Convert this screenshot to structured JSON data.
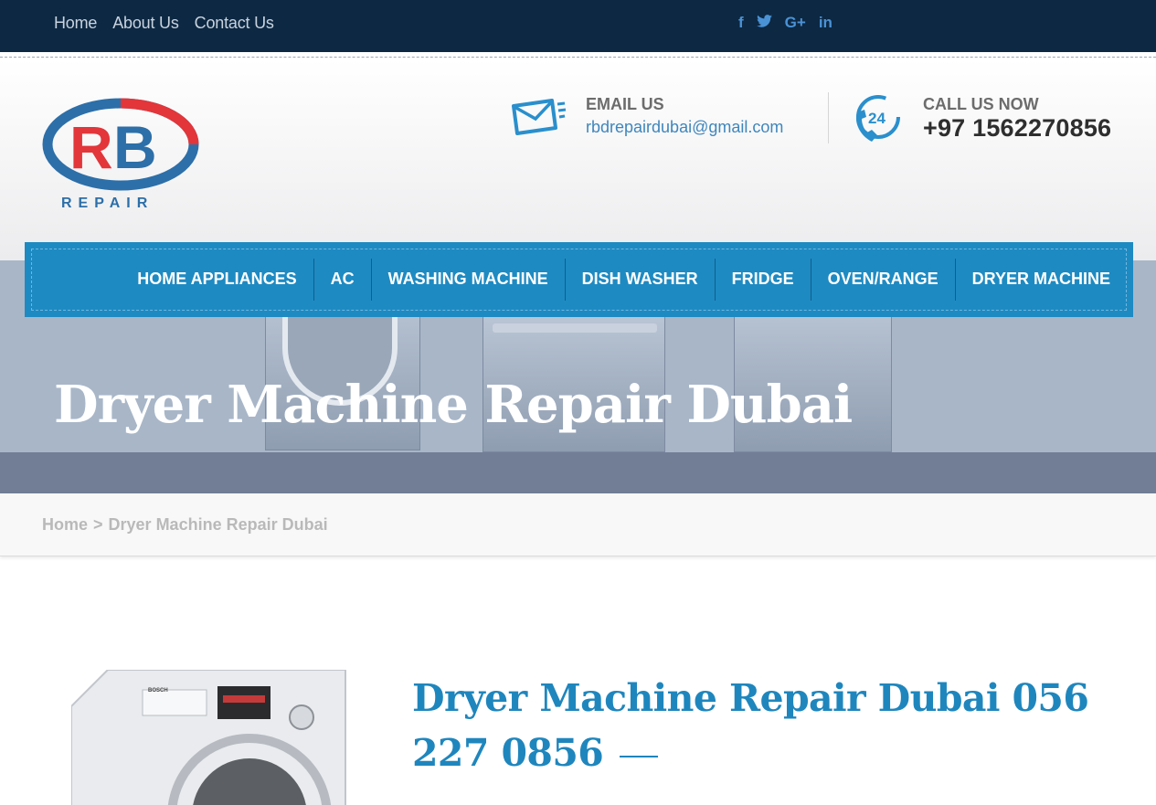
{
  "topbar": {
    "nav": [
      "Home",
      "About Us",
      "Contact Us"
    ],
    "social": [
      "f",
      "t",
      "G+",
      "in"
    ]
  },
  "header": {
    "logo_text": "REPAIR",
    "email_label": "EMAIL US",
    "email": "rbdrepairdubai@gmail.com",
    "call_label": "CALL US NOW",
    "phone": "+97 1562270856",
    "badge": "24"
  },
  "mainnav": [
    "HOME APPLIANCES",
    "AC",
    "WASHING MACHINE",
    "DISH WASHER",
    "FRIDGE",
    "OVEN/RANGE",
    "DRYER MACHINE"
  ],
  "hero": {
    "title": "Dryer Machine Repair Dubai"
  },
  "breadcrumb": {
    "home": "Home",
    "separator": ">",
    "current": "Dryer Machine Repair Dubai"
  },
  "content": {
    "title": "Dryer Machine Repair Dubai 056 227 0856"
  },
  "colors": {
    "topbar": "#0d2843",
    "accent": "#1f86bd",
    "nav": "#1e8ac2"
  }
}
